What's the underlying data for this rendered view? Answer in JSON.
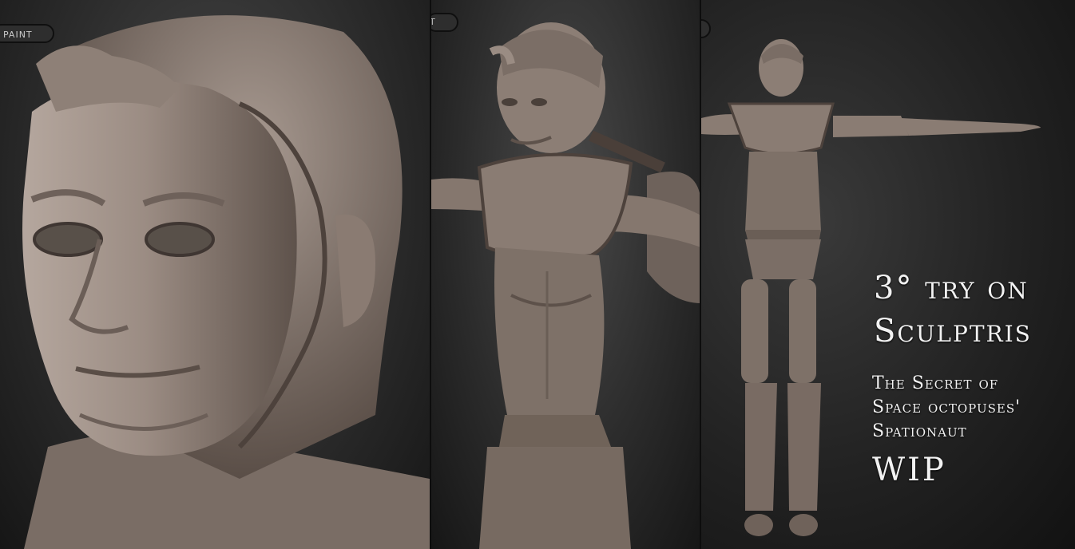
{
  "toolbar": {
    "paint_label": "PAINT",
    "mid_button_label": "T"
  },
  "caption": {
    "line1": "3° try on",
    "line2": "Sculptris",
    "sub1": "The Secret of",
    "sub2": "Space octopuses'",
    "sub3": "Spationaut",
    "wip": "WIP"
  },
  "colors": {
    "clay": "#8a7b72",
    "clay_dark": "#5b4f48",
    "clay_light": "#b1a39a",
    "background": "#2a2a2a"
  }
}
